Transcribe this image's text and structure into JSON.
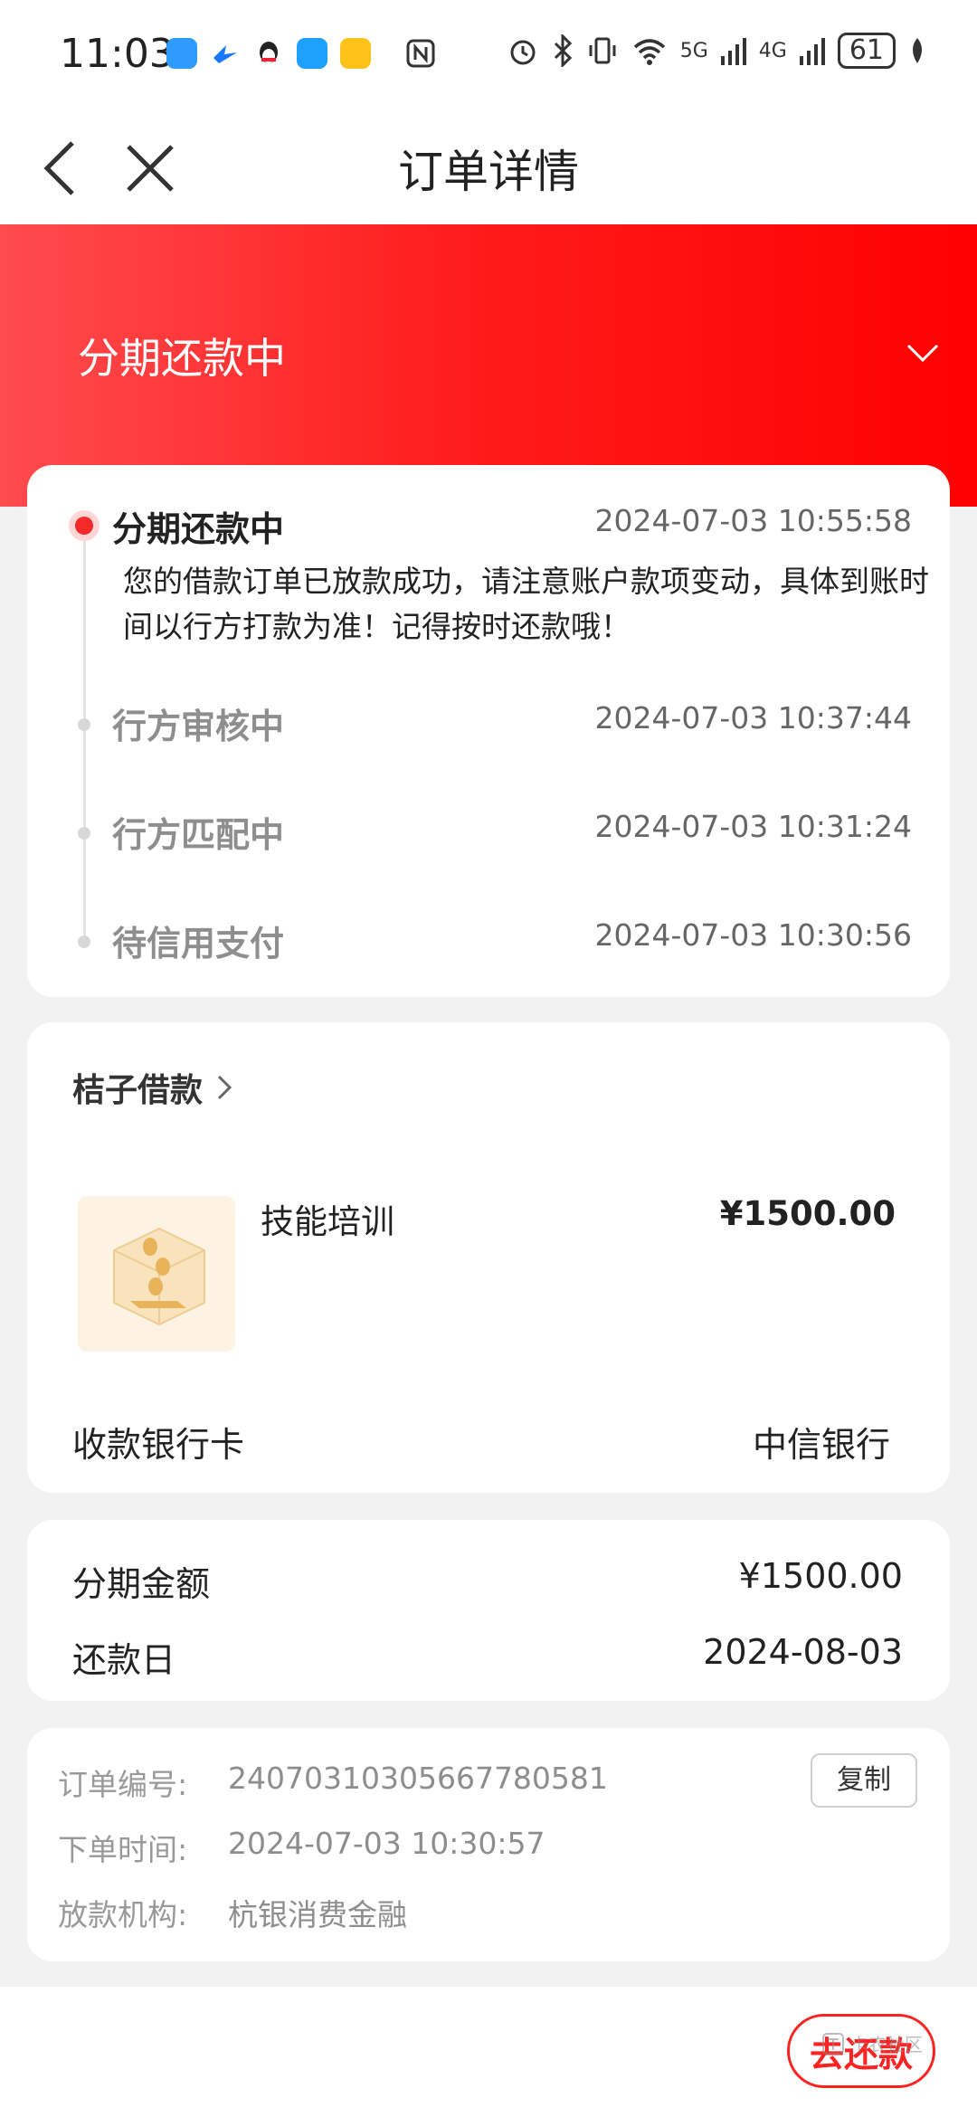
{
  "status_bar": {
    "time": "11:03",
    "network_5g": "5G",
    "network_4g": "4G",
    "battery": "61"
  },
  "nav": {
    "title": "订单详情"
  },
  "banner": {
    "title": "分期还款中"
  },
  "timeline": [
    {
      "title": "分期还款中",
      "time": "2024-07-03 10:55:58",
      "desc": "您的借款订单已放款成功，请注意账户款项变动，具体到账时间以行方打款为准！记得按时还款哦！"
    },
    {
      "title": "行方审核中",
      "time": "2024-07-03 10:37:44"
    },
    {
      "title": "行方匹配中",
      "time": "2024-07-03 10:31:24"
    },
    {
      "title": "待信用支付",
      "time": "2024-07-03 10:30:56"
    }
  ],
  "product": {
    "merchant": "桔子借款",
    "name": "技能培训",
    "price": "¥1500.00",
    "bank_label": "收款银行卡",
    "bank_value": "中信银行"
  },
  "installment": {
    "amount_label": "分期金额",
    "amount_value": "¥1500.00",
    "due_label": "还款日",
    "due_value": "2024-08-03"
  },
  "order": {
    "number_label": "订单编号:",
    "number_value": "24070310305667780581",
    "time_label": "下单时间:",
    "time_value": "2024-07-03 10:30:57",
    "lender_label": "放款机构:",
    "lender_value": "杭银消费金融",
    "copy_label": "复制"
  },
  "bottom": {
    "repay_label": "去还款",
    "watermark_text": "卡农社区"
  },
  "colors": {
    "accent_red": "#ff1a1a"
  }
}
